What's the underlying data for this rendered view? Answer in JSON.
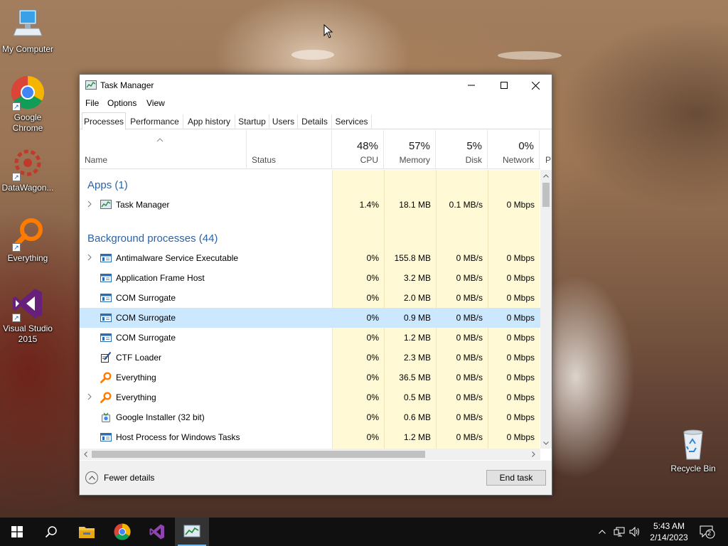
{
  "desktop": {
    "icons": [
      {
        "label": "My Computer"
      },
      {
        "label": "Google Chrome"
      },
      {
        "label": "DataWagon..."
      },
      {
        "label": "Everything"
      },
      {
        "label": "Visual Studio 2015"
      },
      {
        "label": "Recycle Bin"
      }
    ]
  },
  "window": {
    "title": "Task Manager",
    "menu": [
      "File",
      "Options",
      "View"
    ],
    "tabs": [
      "Processes",
      "Performance",
      "App history",
      "Startup",
      "Users",
      "Details",
      "Services"
    ],
    "active_tab": "Processes",
    "columns": {
      "name": "Name",
      "status": "Status",
      "cpu": {
        "percent": "48%",
        "label": "CPU"
      },
      "memory": {
        "percent": "57%",
        "label": "Memory"
      },
      "disk": {
        "percent": "5%",
        "label": "Disk"
      },
      "network": {
        "percent": "0%",
        "label": "Network"
      },
      "next": "P"
    },
    "groups": [
      {
        "title": "Apps (1)",
        "rows": [
          {
            "name": "Task Manager",
            "icon": "task-manager-icon",
            "expandable": true,
            "cpu": "1.4%",
            "memory": "18.1 MB",
            "disk": "0.1 MB/s",
            "network": "0 Mbps"
          }
        ]
      },
      {
        "title": "Background processes (44)",
        "rows": [
          {
            "name": "Antimalware Service Executable",
            "icon": "service-window-icon",
            "expandable": true,
            "cpu": "0%",
            "memory": "155.8 MB",
            "disk": "0 MB/s",
            "network": "0 Mbps"
          },
          {
            "name": "Application Frame Host",
            "icon": "service-window-icon",
            "expandable": false,
            "cpu": "0%",
            "memory": "3.2 MB",
            "disk": "0 MB/s",
            "network": "0 Mbps"
          },
          {
            "name": "COM Surrogate",
            "icon": "service-window-icon",
            "expandable": false,
            "cpu": "0%",
            "memory": "2.0 MB",
            "disk": "0 MB/s",
            "network": "0 Mbps"
          },
          {
            "name": "COM Surrogate",
            "icon": "service-window-icon",
            "expandable": false,
            "selected": true,
            "cpu": "0%",
            "memory": "0.9 MB",
            "disk": "0 MB/s",
            "network": "0 Mbps"
          },
          {
            "name": "COM Surrogate",
            "icon": "service-window-icon",
            "expandable": false,
            "cpu": "0%",
            "memory": "1.2 MB",
            "disk": "0 MB/s",
            "network": "0 Mbps"
          },
          {
            "name": "CTF Loader",
            "icon": "pen-notepad-icon",
            "expandable": false,
            "cpu": "0%",
            "memory": "2.3 MB",
            "disk": "0 MB/s",
            "network": "0 Mbps"
          },
          {
            "name": "Everything",
            "icon": "magnifier-icon",
            "expandable": false,
            "cpu": "0%",
            "memory": "36.5 MB",
            "disk": "0 MB/s",
            "network": "0 Mbps"
          },
          {
            "name": "Everything",
            "icon": "magnifier-icon",
            "expandable": true,
            "cpu": "0%",
            "memory": "0.5 MB",
            "disk": "0 MB/s",
            "network": "0 Mbps"
          },
          {
            "name": "Google Installer (32 bit)",
            "icon": "installer-icon",
            "expandable": false,
            "cpu": "0%",
            "memory": "0.6 MB",
            "disk": "0 MB/s",
            "network": "0 Mbps"
          },
          {
            "name": "Host Process for Windows Tasks",
            "icon": "service-window-icon",
            "expandable": false,
            "cpu": "0%",
            "memory": "1.2 MB",
            "disk": "0 MB/s",
            "network": "0 Mbps"
          }
        ]
      }
    ],
    "footer": {
      "fewer_details": "Fewer details",
      "end_task": "End task"
    }
  },
  "taskbar": {
    "time": "5:43 AM",
    "date": "2/14/2023",
    "notification_count": "2"
  },
  "colors": {
    "group_title": "#2b63a8",
    "heat": "#fff9d6",
    "selected_row": "#cce8ff",
    "taskbar": "#101010",
    "running_indicator": "#76b9ed"
  }
}
